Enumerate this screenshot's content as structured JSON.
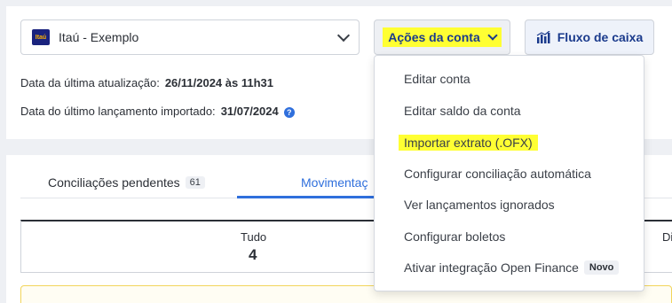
{
  "account_selector": {
    "bank_logo_text": "Itaú",
    "label": "Itaú - Exemplo"
  },
  "actions_button": {
    "label": "Ações da conta"
  },
  "cashflow_button": {
    "label": "Fluxo de caixa"
  },
  "info": {
    "last_update_label": "Data da última atualização:",
    "last_update_value": "26/11/2024 às 11h31",
    "last_import_label": "Data do último lançamento importado:",
    "last_import_value": "31/07/2024"
  },
  "tabs": [
    {
      "label": "Conciliações pendentes",
      "count": "61"
    },
    {
      "label": "Movimentaç"
    }
  ],
  "summary": {
    "label": "Tudo",
    "value": "4",
    "right_label": "Di"
  },
  "menu": {
    "items": [
      {
        "label": "Editar conta"
      },
      {
        "label": "Editar saldo da conta"
      },
      {
        "label": "Importar extrato (.OFX)"
      },
      {
        "label": "Configurar conciliação automática"
      },
      {
        "label": "Ver lançamentos ignorados"
      },
      {
        "label": "Configurar boletos"
      },
      {
        "label": "Ativar integração Open Finance",
        "badge": "Novo"
      }
    ]
  },
  "colors": {
    "accent": "#2f6fdc",
    "highlight": "#ffff33",
    "brand_dark": "#1a3a8c"
  }
}
